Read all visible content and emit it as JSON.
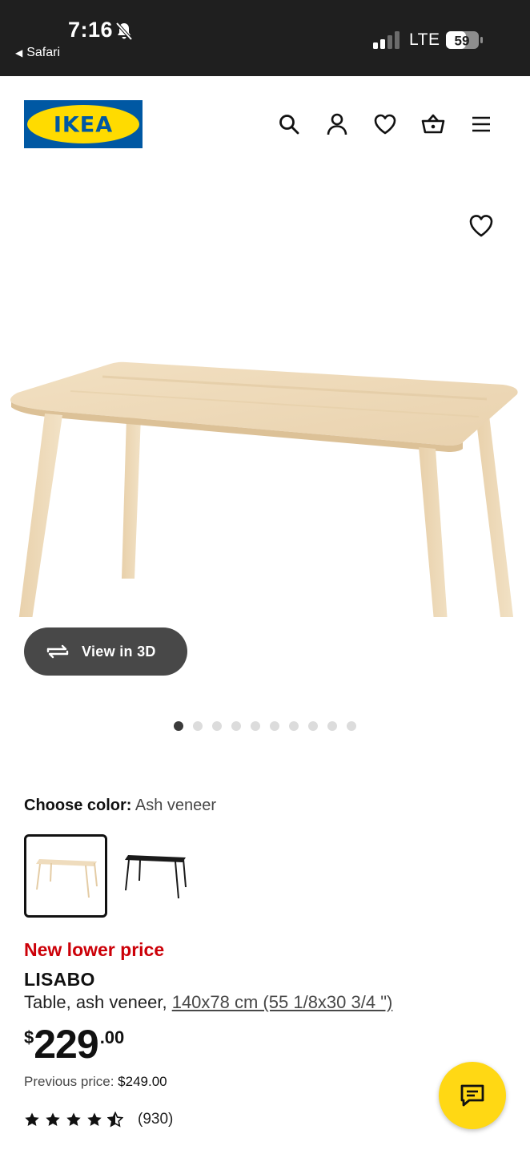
{
  "status_bar": {
    "time": "7:16",
    "back_label": "Safari",
    "network": "LTE",
    "battery": "59"
  },
  "header": {
    "logo_text": "IKEA",
    "icons": [
      "search-icon",
      "account-icon",
      "favorites-icon",
      "cart-icon",
      "menu-icon"
    ]
  },
  "gallery": {
    "view3d_label": "View in 3D",
    "image_count": 10,
    "active_index": 0
  },
  "product": {
    "color_label": "Choose color:",
    "color_value": "Ash veneer",
    "swatches": [
      {
        "name": "Ash veneer",
        "color": "#ecd8b6",
        "selected": true
      },
      {
        "name": "Black",
        "color": "#1a1a1a",
        "selected": false
      }
    ],
    "promo": "New lower price",
    "name": "LISABO",
    "desc_prefix": "Table, ash veneer,",
    "desc_size": "140x78 cm (55 1/8x30 3/4 \")",
    "price_currency": "$",
    "price_int": "229",
    "price_dec": ".00",
    "previous_label": "Previous price:",
    "previous_value": "$249.00",
    "rating": 4.5,
    "review_count": "(930)"
  },
  "colors": {
    "promo_red": "#cc0008",
    "ikea_blue": "#0058a3",
    "ikea_yellow": "#ffdb00",
    "chat_yellow": "#ffd814"
  }
}
